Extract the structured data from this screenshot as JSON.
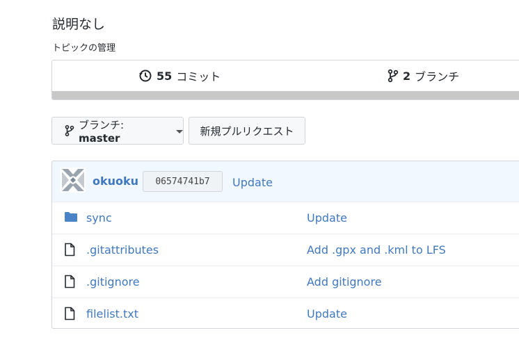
{
  "repo": {
    "description": "説明なし",
    "topics_label": "トピックの管理"
  },
  "summary": {
    "commits_count": "55",
    "commits_label": "コミット",
    "branches_count": "2",
    "branches_label": "ブランチ"
  },
  "toolbar": {
    "branch_prefix": "ブランチ: ",
    "branch_name": "master",
    "new_pr_label": "新規プルリクエスト"
  },
  "latest_commit": {
    "author": "okuoku",
    "sha": "06574741b7",
    "message": "Update"
  },
  "files": [
    {
      "name": "sync",
      "type": "folder",
      "message": "Update"
    },
    {
      "name": ".gitattributes",
      "type": "file",
      "message": "Add .gpx and .kml to LFS"
    },
    {
      "name": ".gitignore",
      "type": "file",
      "message": "Add gitignore"
    },
    {
      "name": "filelist.txt",
      "type": "file",
      "message": "Update"
    }
  ],
  "colors": {
    "link": "#4078c0",
    "commit_bar": "#f1f8ff",
    "summary_bar": "#c8c8c8",
    "folder_icon": "#79b8ff"
  }
}
